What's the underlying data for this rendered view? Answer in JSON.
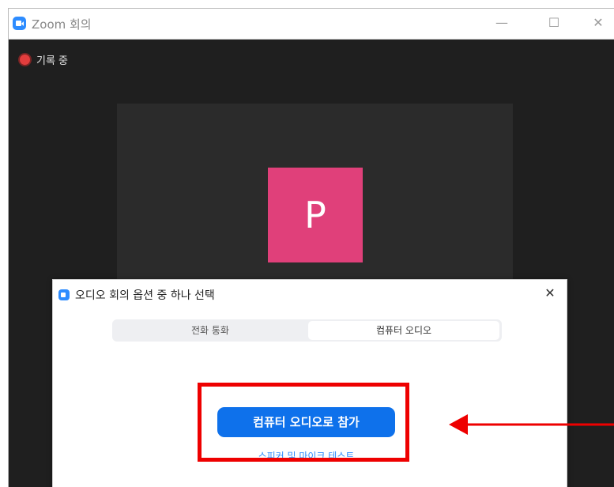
{
  "window": {
    "title": "Zoom 회의",
    "controls": {
      "minimize": "—",
      "maximize": "☐",
      "close": "✕"
    }
  },
  "recording": {
    "label": "기록 중"
  },
  "participant": {
    "avatar_initial": "P",
    "avatar_color": "#e0407a"
  },
  "audio_dialog": {
    "title": "오디오 회의 옵션 중 하나 선택",
    "close": "✕",
    "tabs": [
      {
        "label": "전화 통화",
        "selected": false
      },
      {
        "label": "컴퓨터 오디오",
        "selected": true
      }
    ],
    "join_button": "컴퓨터 오디오로 참가",
    "test_link": "스피커 및 마이크 테스트"
  },
  "annotation": {
    "color": "#ee0000"
  },
  "colors": {
    "accent": "#0e71eb",
    "link": "#2d8cff",
    "background": "#1f1f1f"
  }
}
